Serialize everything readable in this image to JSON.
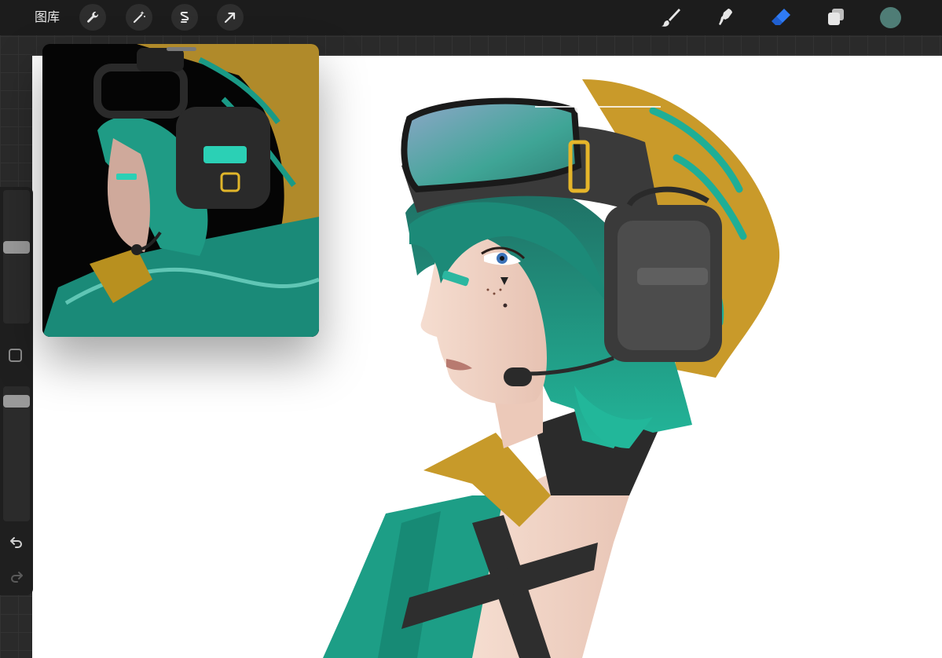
{
  "toolbar": {
    "gallery_label": "图库",
    "left_tools": [
      "wrench-icon",
      "magic-wand-icon",
      "selection-icon",
      "transform-arrow-icon"
    ],
    "right_tools": [
      "brush-icon",
      "smudge-icon",
      "eraser-icon",
      "layers-icon"
    ],
    "active_tool": "eraser",
    "current_color": "#4f7d76"
  },
  "sidebar": {
    "brush_size_level": 0.42,
    "opacity_level": 0.07,
    "icons": [
      "modify-square-icon",
      "undo-icon",
      "redo-icon"
    ]
  },
  "reference_window": {
    "image_description_icon": "reference-image"
  },
  "colors": {
    "accent_blue": "#2f7bf5",
    "hair_teal": "#1fae96",
    "bandana_gold": "#c99a2a",
    "headset_gray": "#3a3a3a"
  }
}
